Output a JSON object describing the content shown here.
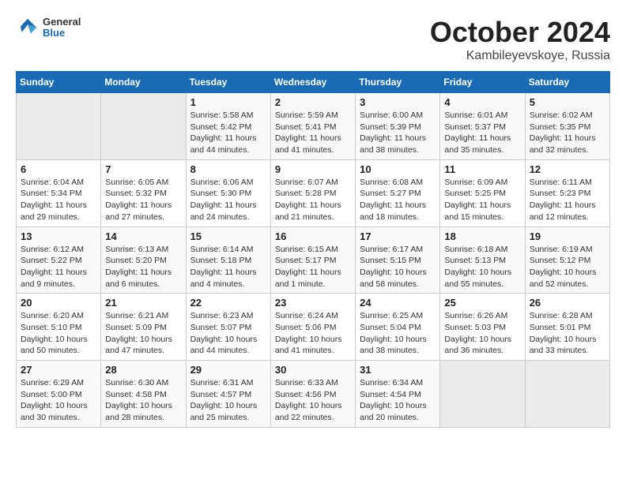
{
  "header": {
    "logo": {
      "general": "General",
      "blue": "Blue"
    },
    "month": "October 2024",
    "location": "Kambileyevskoye, Russia"
  },
  "weekdays": [
    "Sunday",
    "Monday",
    "Tuesday",
    "Wednesday",
    "Thursday",
    "Friday",
    "Saturday"
  ],
  "weeks": [
    [
      {
        "day": "",
        "sunrise": "",
        "sunset": "",
        "daylight": ""
      },
      {
        "day": "",
        "sunrise": "",
        "sunset": "",
        "daylight": ""
      },
      {
        "day": "1",
        "sunrise": "Sunrise: 5:58 AM",
        "sunset": "Sunset: 5:42 PM",
        "daylight": "Daylight: 11 hours and 44 minutes."
      },
      {
        "day": "2",
        "sunrise": "Sunrise: 5:59 AM",
        "sunset": "Sunset: 5:41 PM",
        "daylight": "Daylight: 11 hours and 41 minutes."
      },
      {
        "day": "3",
        "sunrise": "Sunrise: 6:00 AM",
        "sunset": "Sunset: 5:39 PM",
        "daylight": "Daylight: 11 hours and 38 minutes."
      },
      {
        "day": "4",
        "sunrise": "Sunrise: 6:01 AM",
        "sunset": "Sunset: 5:37 PM",
        "daylight": "Daylight: 11 hours and 35 minutes."
      },
      {
        "day": "5",
        "sunrise": "Sunrise: 6:02 AM",
        "sunset": "Sunset: 5:35 PM",
        "daylight": "Daylight: 11 hours and 32 minutes."
      }
    ],
    [
      {
        "day": "6",
        "sunrise": "Sunrise: 6:04 AM",
        "sunset": "Sunset: 5:34 PM",
        "daylight": "Daylight: 11 hours and 29 minutes."
      },
      {
        "day": "7",
        "sunrise": "Sunrise: 6:05 AM",
        "sunset": "Sunset: 5:32 PM",
        "daylight": "Daylight: 11 hours and 27 minutes."
      },
      {
        "day": "8",
        "sunrise": "Sunrise: 6:06 AM",
        "sunset": "Sunset: 5:30 PM",
        "daylight": "Daylight: 11 hours and 24 minutes."
      },
      {
        "day": "9",
        "sunrise": "Sunrise: 6:07 AM",
        "sunset": "Sunset: 5:28 PM",
        "daylight": "Daylight: 11 hours and 21 minutes."
      },
      {
        "day": "10",
        "sunrise": "Sunrise: 6:08 AM",
        "sunset": "Sunset: 5:27 PM",
        "daylight": "Daylight: 11 hours and 18 minutes."
      },
      {
        "day": "11",
        "sunrise": "Sunrise: 6:09 AM",
        "sunset": "Sunset: 5:25 PM",
        "daylight": "Daylight: 11 hours and 15 minutes."
      },
      {
        "day": "12",
        "sunrise": "Sunrise: 6:11 AM",
        "sunset": "Sunset: 5:23 PM",
        "daylight": "Daylight: 11 hours and 12 minutes."
      }
    ],
    [
      {
        "day": "13",
        "sunrise": "Sunrise: 6:12 AM",
        "sunset": "Sunset: 5:22 PM",
        "daylight": "Daylight: 11 hours and 9 minutes."
      },
      {
        "day": "14",
        "sunrise": "Sunrise: 6:13 AM",
        "sunset": "Sunset: 5:20 PM",
        "daylight": "Daylight: 11 hours and 6 minutes."
      },
      {
        "day": "15",
        "sunrise": "Sunrise: 6:14 AM",
        "sunset": "Sunset: 5:18 PM",
        "daylight": "Daylight: 11 hours and 4 minutes."
      },
      {
        "day": "16",
        "sunrise": "Sunrise: 6:15 AM",
        "sunset": "Sunset: 5:17 PM",
        "daylight": "Daylight: 11 hours and 1 minute."
      },
      {
        "day": "17",
        "sunrise": "Sunrise: 6:17 AM",
        "sunset": "Sunset: 5:15 PM",
        "daylight": "Daylight: 10 hours and 58 minutes."
      },
      {
        "day": "18",
        "sunrise": "Sunrise: 6:18 AM",
        "sunset": "Sunset: 5:13 PM",
        "daylight": "Daylight: 10 hours and 55 minutes."
      },
      {
        "day": "19",
        "sunrise": "Sunrise: 6:19 AM",
        "sunset": "Sunset: 5:12 PM",
        "daylight": "Daylight: 10 hours and 52 minutes."
      }
    ],
    [
      {
        "day": "20",
        "sunrise": "Sunrise: 6:20 AM",
        "sunset": "Sunset: 5:10 PM",
        "daylight": "Daylight: 10 hours and 50 minutes."
      },
      {
        "day": "21",
        "sunrise": "Sunrise: 6:21 AM",
        "sunset": "Sunset: 5:09 PM",
        "daylight": "Daylight: 10 hours and 47 minutes."
      },
      {
        "day": "22",
        "sunrise": "Sunrise: 6:23 AM",
        "sunset": "Sunset: 5:07 PM",
        "daylight": "Daylight: 10 hours and 44 minutes."
      },
      {
        "day": "23",
        "sunrise": "Sunrise: 6:24 AM",
        "sunset": "Sunset: 5:06 PM",
        "daylight": "Daylight: 10 hours and 41 minutes."
      },
      {
        "day": "24",
        "sunrise": "Sunrise: 6:25 AM",
        "sunset": "Sunset: 5:04 PM",
        "daylight": "Daylight: 10 hours and 38 minutes."
      },
      {
        "day": "25",
        "sunrise": "Sunrise: 6:26 AM",
        "sunset": "Sunset: 5:03 PM",
        "daylight": "Daylight: 10 hours and 36 minutes."
      },
      {
        "day": "26",
        "sunrise": "Sunrise: 6:28 AM",
        "sunset": "Sunset: 5:01 PM",
        "daylight": "Daylight: 10 hours and 33 minutes."
      }
    ],
    [
      {
        "day": "27",
        "sunrise": "Sunrise: 6:29 AM",
        "sunset": "Sunset: 5:00 PM",
        "daylight": "Daylight: 10 hours and 30 minutes."
      },
      {
        "day": "28",
        "sunrise": "Sunrise: 6:30 AM",
        "sunset": "Sunset: 4:58 PM",
        "daylight": "Daylight: 10 hours and 28 minutes."
      },
      {
        "day": "29",
        "sunrise": "Sunrise: 6:31 AM",
        "sunset": "Sunset: 4:57 PM",
        "daylight": "Daylight: 10 hours and 25 minutes."
      },
      {
        "day": "30",
        "sunrise": "Sunrise: 6:33 AM",
        "sunset": "Sunset: 4:56 PM",
        "daylight": "Daylight: 10 hours and 22 minutes."
      },
      {
        "day": "31",
        "sunrise": "Sunrise: 6:34 AM",
        "sunset": "Sunset: 4:54 PM",
        "daylight": "Daylight: 10 hours and 20 minutes."
      },
      {
        "day": "",
        "sunrise": "",
        "sunset": "",
        "daylight": ""
      },
      {
        "day": "",
        "sunrise": "",
        "sunset": "",
        "daylight": ""
      }
    ]
  ]
}
